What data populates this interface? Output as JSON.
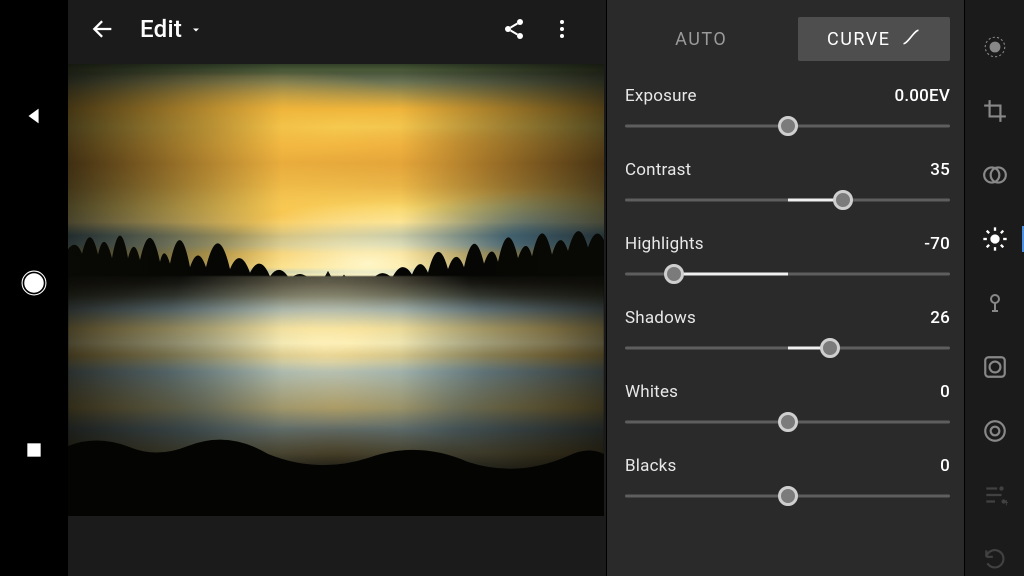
{
  "header": {
    "title": "Edit"
  },
  "tabs": {
    "auto": "AUTO",
    "curve": "CURVE"
  },
  "sliders": [
    {
      "label": "Exposure",
      "value": "0.00EV",
      "pos": 50,
      "fill_from": 50,
      "fill_to": 50
    },
    {
      "label": "Contrast",
      "value": "35",
      "pos": 67,
      "fill_from": 50,
      "fill_to": 67
    },
    {
      "label": "Highlights",
      "value": "-70",
      "pos": 15,
      "fill_from": 15,
      "fill_to": 50
    },
    {
      "label": "Shadows",
      "value": "26",
      "pos": 63,
      "fill_from": 50,
      "fill_to": 63
    },
    {
      "label": "Whites",
      "value": "0",
      "pos": 50,
      "fill_from": 50,
      "fill_to": 50
    },
    {
      "label": "Blacks",
      "value": "0",
      "pos": 50,
      "fill_from": 50,
      "fill_to": 50
    }
  ]
}
